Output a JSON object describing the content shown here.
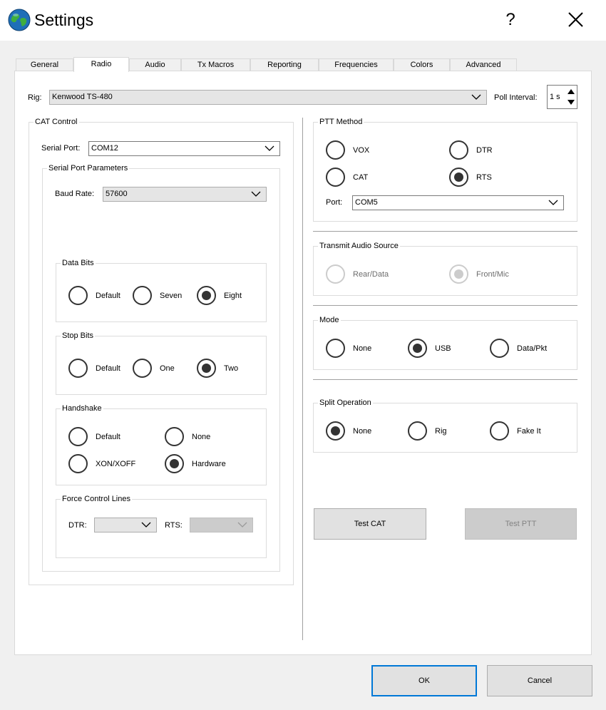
{
  "window": {
    "title": "Settings",
    "help_glyph": "?"
  },
  "tabs": [
    {
      "label": "General"
    },
    {
      "label": "Radio",
      "active": true
    },
    {
      "label": "Audio"
    },
    {
      "label": "Tx Macros"
    },
    {
      "label": "Reporting"
    },
    {
      "label": "Frequencies"
    },
    {
      "label": "Colors"
    },
    {
      "label": "Advanced"
    }
  ],
  "rig": {
    "label": "Rig:",
    "value": "Kenwood TS-480"
  },
  "poll": {
    "label": "Poll Interval:",
    "value": "1 s"
  },
  "cat_control": {
    "title": "CAT Control",
    "serial_port": {
      "label": "Serial Port:",
      "value": "COM12"
    },
    "serial_params": {
      "title": "Serial Port Parameters",
      "baud": {
        "label": "Baud Rate:",
        "value": "57600"
      },
      "data_bits": {
        "title": "Data Bits",
        "options": [
          "Default",
          "Seven",
          "Eight"
        ],
        "selected": "Eight"
      },
      "stop_bits": {
        "title": "Stop Bits",
        "options": [
          "Default",
          "One",
          "Two"
        ],
        "selected": "Two"
      },
      "handshake": {
        "title": "Handshake",
        "options": [
          "Default",
          "None",
          "XON/XOFF",
          "Hardware"
        ],
        "selected": "Hardware"
      },
      "force_lines": {
        "title": "Force Control Lines",
        "dtr_label": "DTR:",
        "dtr_value": "",
        "rts_label": "RTS:",
        "rts_value": ""
      }
    }
  },
  "ptt": {
    "title": "PTT Method",
    "options": [
      "VOX",
      "DTR",
      "CAT",
      "RTS"
    ],
    "selected": "RTS",
    "port": {
      "label": "Port:",
      "value": "COM5"
    }
  },
  "tx_audio": {
    "title": "Transmit Audio Source",
    "options": [
      "Rear/Data",
      "Front/Mic"
    ],
    "selected": "Front/Mic"
  },
  "mode": {
    "title": "Mode",
    "options": [
      "None",
      "USB",
      "Data/Pkt"
    ],
    "selected": "USB"
  },
  "split": {
    "title": "Split Operation",
    "options": [
      "None",
      "Rig",
      "Fake It"
    ],
    "selected": "None"
  },
  "buttons": {
    "test_cat": "Test CAT",
    "test_ptt": "Test PTT",
    "ok": "OK",
    "cancel": "Cancel"
  },
  "colors": {
    "accent": "#0078d7",
    "panel": "#ffffff",
    "background": "#f0f0f0"
  }
}
